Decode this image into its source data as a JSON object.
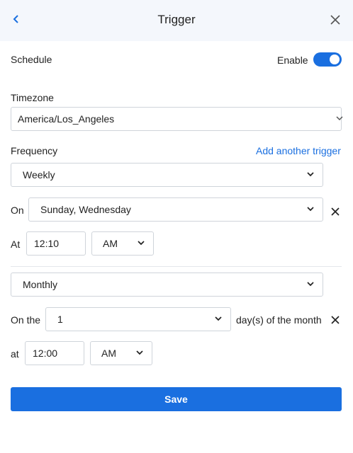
{
  "header": {
    "title": "Trigger"
  },
  "schedule": {
    "label": "Schedule",
    "enable_label": "Enable",
    "enabled": true
  },
  "timezone": {
    "label": "Timezone",
    "value": "America/Los_Angeles"
  },
  "frequency": {
    "label": "Frequency",
    "add_trigger_label": "Add another trigger"
  },
  "trigger1": {
    "frequency": "Weekly",
    "on_label": "On",
    "days": "Sunday, Wednesday",
    "at_label": "At",
    "time": "12:10",
    "ampm": "AM"
  },
  "trigger2": {
    "frequency": "Monthly",
    "on_the_label": "On the",
    "day": "1",
    "suffix": "day(s) of the month",
    "at_label": "at",
    "time": "12:00",
    "ampm": "AM"
  },
  "save_label": "Save",
  "colors": {
    "accent": "#1a6fe0",
    "header_bg": "#f4f7fc",
    "border": "#cfd4da"
  }
}
